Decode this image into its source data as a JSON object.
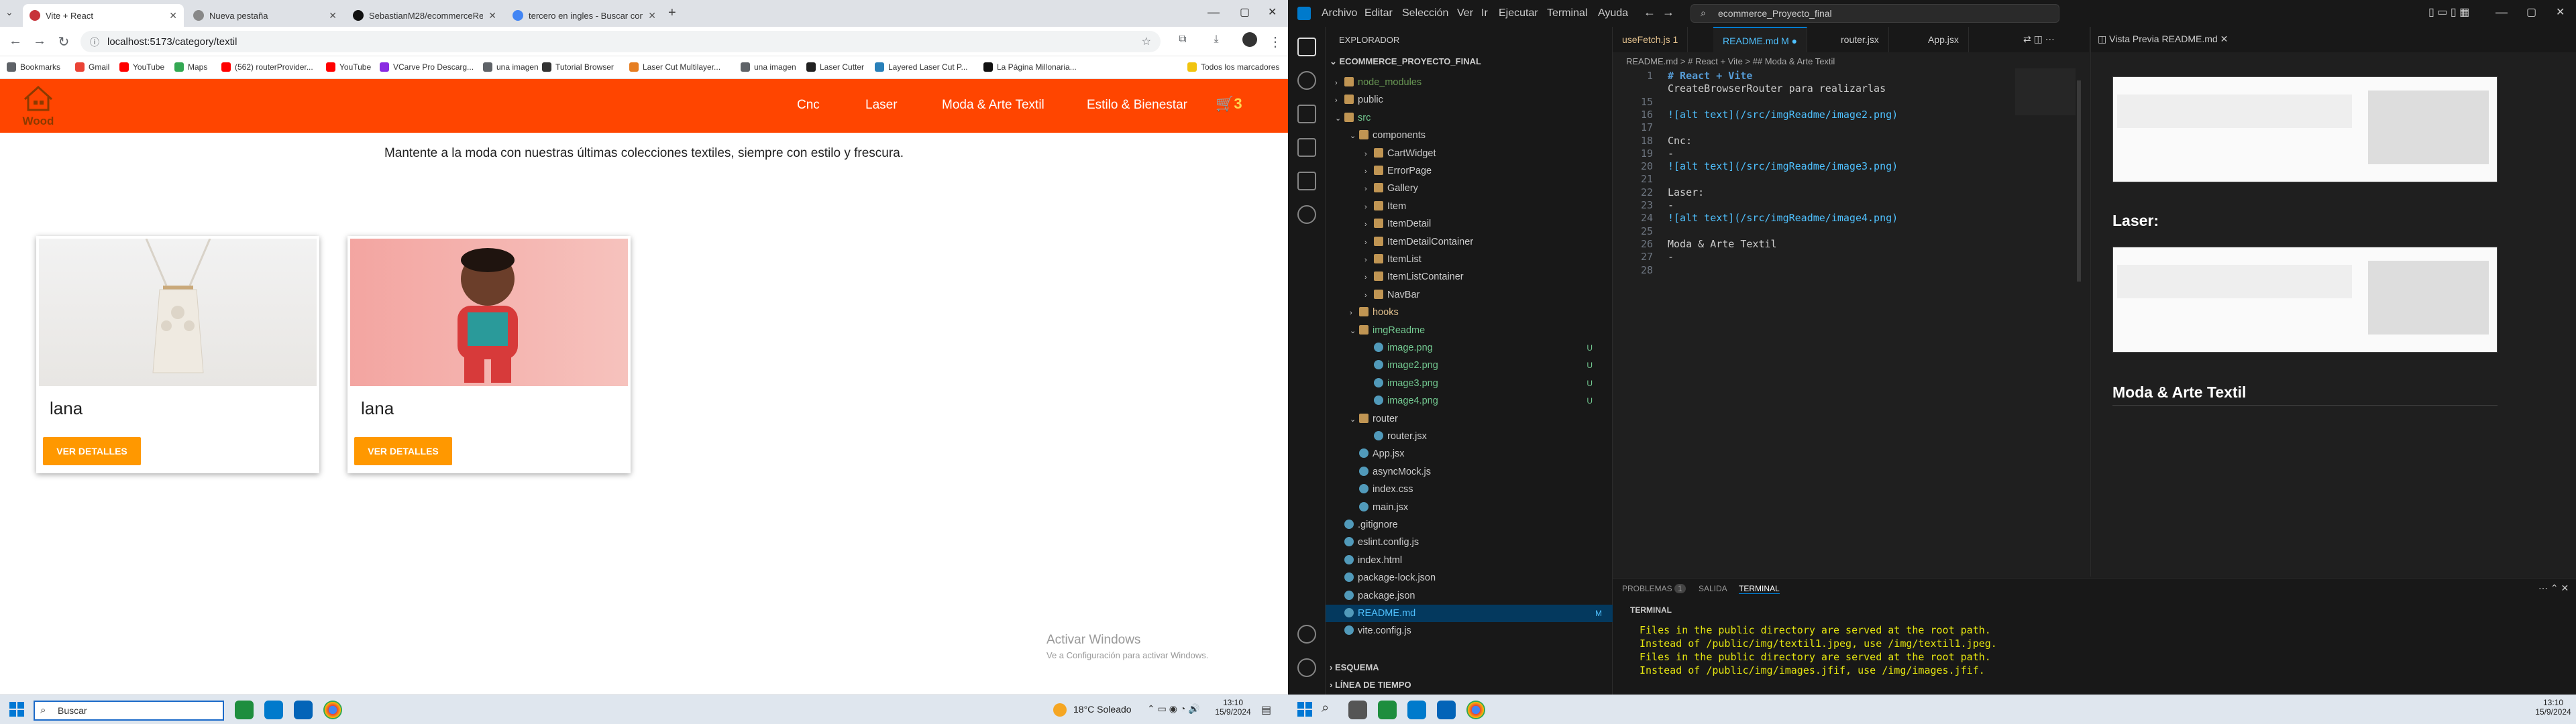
{
  "browser": {
    "tabs": [
      {
        "title": "Vite + React",
        "active": true
      },
      {
        "title": "Nueva pestaña",
        "active": false
      },
      {
        "title": "SebastianM28/ecommerceReact",
        "active": false
      },
      {
        "title": "tercero en ingles - Buscar con",
        "active": false
      }
    ],
    "url": "localhost:5173/category/textil",
    "bookmarks": [
      "Bookmarks",
      "Gmail",
      "YouTube",
      "Maps",
      "(562) routerProvider...",
      "YouTube",
      "VCarve Pro Descarg...",
      "una imagen",
      "Tutorial Browser",
      "Laser Cut Multilayer...",
      "una imagen",
      "Laser Cutter",
      "Layered Laser Cut P...",
      "La Página Millonaria..."
    ],
    "all_bookmarks": "Todos los marcadores"
  },
  "site": {
    "logo": "Wood",
    "nav": [
      "Cnc",
      "Laser",
      "Moda & Arte Textil",
      "Estilo & Bienestar"
    ],
    "cart_count": "3",
    "hero": "Mantente a la moda con nuestras últimas colecciones textiles, siempre con estilo y frescura.",
    "cards": [
      {
        "title": "lana",
        "button": "VER DETALLES"
      },
      {
        "title": "lana",
        "button": "VER DETALLES"
      }
    ],
    "watermark_title": "Activar Windows",
    "watermark_sub": "Ve a Configuración para activar Windows."
  },
  "taskbar_left": {
    "search": "Buscar",
    "weather": "18°C  Soleado",
    "time": "13:10",
    "date": "15/9/2024"
  },
  "vscode": {
    "menu": [
      "Archivo",
      "Editar",
      "Selección",
      "Ver",
      "Ir",
      "Ejecutar",
      "Terminal",
      "Ayuda"
    ],
    "command_center": "ecommerce_Proyecto_final",
    "explorer_title": "EXPLORADOR",
    "project": "ECOMMERCE_PROYECTO_FINAL",
    "tree": [
      {
        "name": "node_modules",
        "depth": 0,
        "type": "folder",
        "open": false,
        "color": "#6a9955"
      },
      {
        "name": "public",
        "depth": 0,
        "type": "folder",
        "open": false,
        "color": "#cccccc"
      },
      {
        "name": "src",
        "depth": 0,
        "type": "folder",
        "open": true,
        "color": "#73c991"
      },
      {
        "name": "components",
        "depth": 1,
        "type": "folder",
        "open": true,
        "color": "#cccccc"
      },
      {
        "name": "CartWidget",
        "depth": 2,
        "type": "folder",
        "open": false,
        "color": "#cccccc"
      },
      {
        "name": "ErrorPage",
        "depth": 2,
        "type": "folder",
        "open": false,
        "color": "#cccccc"
      },
      {
        "name": "Gallery",
        "depth": 2,
        "type": "folder",
        "open": false,
        "color": "#cccccc"
      },
      {
        "name": "Item",
        "depth": 2,
        "type": "folder",
        "open": false,
        "color": "#cccccc"
      },
      {
        "name": "ItemDetail",
        "depth": 2,
        "type": "folder",
        "open": false,
        "color": "#cccccc"
      },
      {
        "name": "ItemDetailContainer",
        "depth": 2,
        "type": "folder",
        "open": false,
        "color": "#cccccc"
      },
      {
        "name": "ItemList",
        "depth": 2,
        "type": "folder",
        "open": false,
        "color": "#cccccc"
      },
      {
        "name": "ItemListContainer",
        "depth": 2,
        "type": "folder",
        "open": false,
        "color": "#cccccc"
      },
      {
        "name": "NavBar",
        "depth": 2,
        "type": "folder",
        "open": false,
        "color": "#cccccc"
      },
      {
        "name": "hooks",
        "depth": 1,
        "type": "folder",
        "open": false,
        "color": "#e2c08d"
      },
      {
        "name": "imgReadme",
        "depth": 1,
        "type": "folder",
        "open": true,
        "color": "#73c991"
      },
      {
        "name": "image.png",
        "depth": 2,
        "type": "file",
        "color": "#73c991",
        "badge": "U"
      },
      {
        "name": "image2.png",
        "depth": 2,
        "type": "file",
        "color": "#73c991",
        "badge": "U"
      },
      {
        "name": "image3.png",
        "depth": 2,
        "type": "file",
        "color": "#73c991",
        "badge": "U"
      },
      {
        "name": "image4.png",
        "depth": 2,
        "type": "file",
        "color": "#73c991",
        "badge": "U"
      },
      {
        "name": "router",
        "depth": 1,
        "type": "folder",
        "open": true,
        "color": "#cccccc"
      },
      {
        "name": "router.jsx",
        "depth": 2,
        "type": "file",
        "color": "#cccccc"
      },
      {
        "name": "App.jsx",
        "depth": 1,
        "type": "file",
        "color": "#cccccc"
      },
      {
        "name": "asyncMock.js",
        "depth": 1,
        "type": "file",
        "color": "#cccccc"
      },
      {
        "name": "index.css",
        "depth": 1,
        "type": "file",
        "color": "#cccccc"
      },
      {
        "name": "main.jsx",
        "depth": 1,
        "type": "file",
        "color": "#cccccc"
      },
      {
        "name": ".gitignore",
        "depth": 0,
        "type": "file",
        "color": "#cccccc"
      },
      {
        "name": "eslint.config.js",
        "depth": 0,
        "type": "file",
        "color": "#cccccc"
      },
      {
        "name": "index.html",
        "depth": 0,
        "type": "file",
        "color": "#cccccc"
      },
      {
        "name": "package-lock.json",
        "depth": 0,
        "type": "file",
        "color": "#cccccc"
      },
      {
        "name": "package.json",
        "depth": 0,
        "type": "file",
        "color": "#cccccc"
      },
      {
        "name": "README.md",
        "depth": 0,
        "type": "file",
        "color": "#4fc1ff",
        "badge": "M",
        "selected": true
      },
      {
        "name": "vite.config.js",
        "depth": 0,
        "type": "file",
        "color": "#cccccc"
      }
    ],
    "outline": "ESQUEMA",
    "timeline": "LÍNEA DE TIEMPO",
    "editor_tabs": [
      "useFetch.js 1",
      "README.md M",
      "router.jsx",
      "App.jsx"
    ],
    "breadcrumb": "README.md > # React + Vite > ## Moda & Arte Textil",
    "code_lines": [
      {
        "n": "1",
        "text": "# React + Vite"
      },
      {
        "n": "",
        "text": "CreateBrowserRouter para realizarlas"
      },
      {
        "n": "15",
        "text": ""
      },
      {
        "n": "16",
        "text": "![alt text](/src/imgReadme/image2.png)"
      },
      {
        "n": "17",
        "text": ""
      },
      {
        "n": "18",
        "text": "Cnc:"
      },
      {
        "n": "19",
        "text": "-"
      },
      {
        "n": "20",
        "text": "![alt text](/src/imgReadme/image3.png)"
      },
      {
        "n": "21",
        "text": ""
      },
      {
        "n": "22",
        "text": "Laser:"
      },
      {
        "n": "23",
        "text": "-"
      },
      {
        "n": "24",
        "text": "![alt text](/src/imgReadme/image4.png)"
      },
      {
        "n": "25",
        "text": ""
      },
      {
        "n": "26",
        "text": "Moda & Arte Textil"
      },
      {
        "n": "27",
        "text": "-"
      },
      {
        "n": "28",
        "text": ""
      }
    ],
    "preview_tab": "Vista Previa README.md",
    "preview_headings": [
      "Laser:",
      "Moda & Arte Textil"
    ],
    "panel_tabs": [
      "PROBLEMAS",
      "1",
      "SALIDA",
      "TERMINAL"
    ],
    "terminal_label": "TERMINAL",
    "terminal_lines": [
      "Files in the public directory are served at the root path.",
      "Instead of /public/img/textil1.jpeg, use /img/textil1.jpeg.",
      "Files in the public directory are served at the root path.",
      "Instead of /public/img/images.jfif, use /img/images.jfif."
    ],
    "time": "13:10",
    "date": "15/9/2024"
  }
}
